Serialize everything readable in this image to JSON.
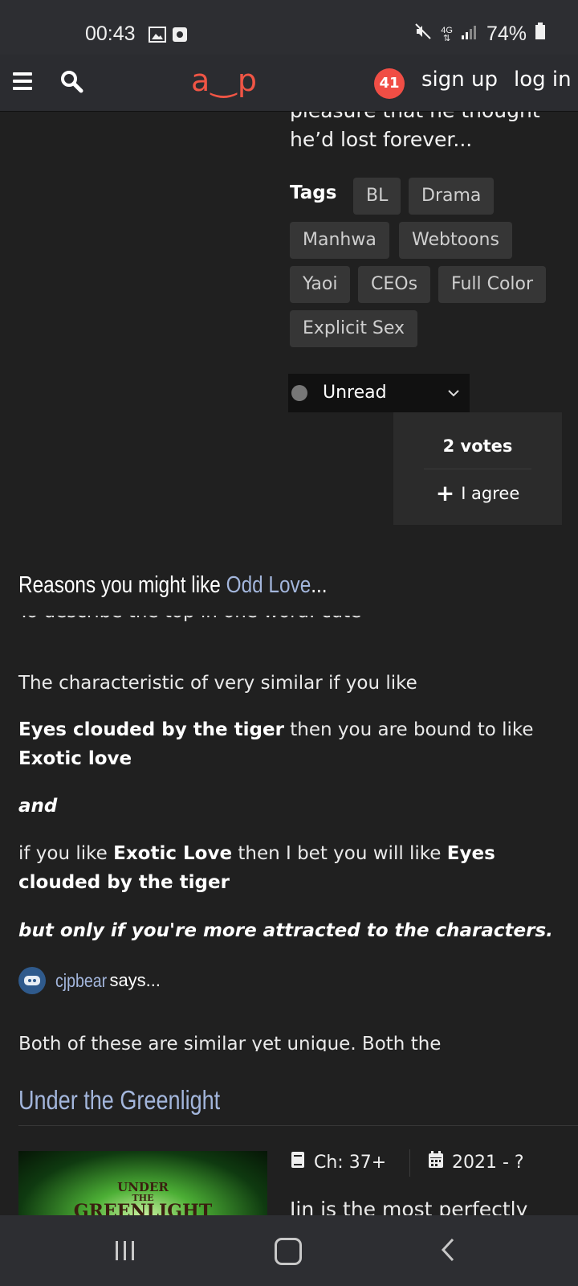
{
  "status_bar": {
    "time": "00:43",
    "battery": "74%",
    "network": "4G"
  },
  "header": {
    "logo": "a‿p",
    "notification_count": "41",
    "signup": "sign up",
    "login": "log in"
  },
  "manga": {
    "description_tail": [
      "pleasure that he thought",
      "he’d lost forever..."
    ],
    "tags_label": "Tags",
    "tags": [
      "BL",
      "Drama",
      "Manhwa",
      "Webtoons",
      "Yaoi",
      "CEOs",
      "Full Color",
      "Explicit Sex"
    ],
    "status_select": "Unread",
    "votes": "2 votes",
    "agree": "I agree"
  },
  "reasons": {
    "heading_prefix": "Reasons you might like ",
    "heading_title": "Odd Love",
    "heading_suffix": "...",
    "cut_line": "To describe the top in one word: cute",
    "p1": "The characteristic of very similar if you like",
    "p2_b1": "Eyes clouded by the tiger",
    "p2_t1": " then you are bound to like ",
    "p2_b2": "Exotic love",
    "p3": "and",
    "p4_t1": "if you like ",
    "p4_b1": "Exotic Love",
    "p4_t2": " then I bet you will like ",
    "p4_b2": "Eyes clouded by the tiger",
    "p5": "but only if you're more attracted to the characters.",
    "user": "cjpbear",
    "says": " says...",
    "next_text": "Both of these are similar yet unique. Both the"
  },
  "next_item": {
    "title": "Under the Greenlight",
    "chapters": "Ch: 37+",
    "years": "2021 - ?",
    "cover_line1": "UNDER",
    "cover_line2": "THE",
    "cover_line3": "GREENLIGHT",
    "description": "Jin is the most perfectly"
  },
  "colors": {
    "accent": "#f05545",
    "link": "#a3b6dc",
    "background": "#202020"
  }
}
